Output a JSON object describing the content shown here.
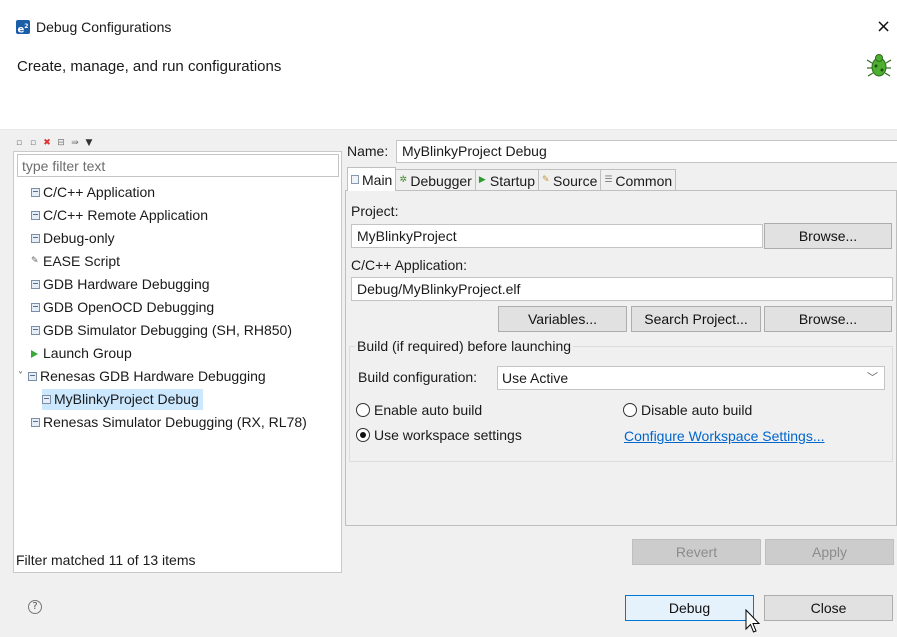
{
  "window": {
    "title": "Debug Configurations",
    "header": "Create, manage, and run configurations",
    "app_icon_text": "e",
    "app_icon_sup": "2",
    "close_glyph": "×"
  },
  "left": {
    "filter_placeholder": "type filter text",
    "tree": [
      {
        "label": "C/C++ Application",
        "icon": "cpp-app-icon"
      },
      {
        "label": "C/C++ Remote Application",
        "icon": "cpp-remote-icon"
      },
      {
        "label": "Debug-only",
        "icon": "debug-only-icon"
      },
      {
        "label": "EASE Script",
        "icon": "ease-script-icon"
      },
      {
        "label": "GDB Hardware Debugging",
        "icon": "gdb-hw-icon"
      },
      {
        "label": "GDB OpenOCD Debugging",
        "icon": "gdb-openocd-icon"
      },
      {
        "label": "GDB Simulator Debugging (SH, RH850)",
        "icon": "gdb-sim-icon"
      },
      {
        "label": "Launch Group",
        "icon": "launch-group-icon"
      },
      {
        "label": "Renesas GDB Hardware Debugging",
        "icon": "renesas-gdb-icon",
        "expanded": true
      },
      {
        "label": "MyBlinkyProject Debug",
        "icon": "config-icon",
        "selected": true
      },
      {
        "label": "Renesas Simulator Debugging (RX, RL78)",
        "icon": "renesas-sim-icon"
      }
    ],
    "status": "Filter matched 11 of 13 items"
  },
  "right": {
    "name_label": "Name:",
    "name_value": "MyBlinkyProject Debug",
    "tabs": [
      {
        "label": "Main",
        "active": true,
        "icon": "main-tab-icon"
      },
      {
        "label": "Debugger",
        "icon": "debugger-tab-icon"
      },
      {
        "label": "Startup",
        "icon": "startup-tab-icon"
      },
      {
        "label": "Source",
        "icon": "source-tab-icon"
      },
      {
        "label": "Common",
        "icon": "common-tab-icon"
      }
    ],
    "project_label": "Project:",
    "project_value": "MyBlinkyProject",
    "browse_label": "Browse...",
    "app_label": "C/C++ Application:",
    "app_value": "Debug/MyBlinkyProject.elf",
    "variables_label": "Variables...",
    "search_label": "Search Project...",
    "build_group_label": "Build (if required) before launching",
    "build_config_label": "Build configuration:",
    "build_config_value": "Use Active",
    "radio_enable": "Enable auto build",
    "radio_disable": "Disable auto build",
    "radio_workspace": "Use workspace settings",
    "config_link": "Configure Workspace Settings...",
    "revert_label": "Revert",
    "apply_label": "Apply"
  },
  "footer": {
    "help_glyph": "?",
    "debug_label": "Debug",
    "close_label": "Close"
  }
}
